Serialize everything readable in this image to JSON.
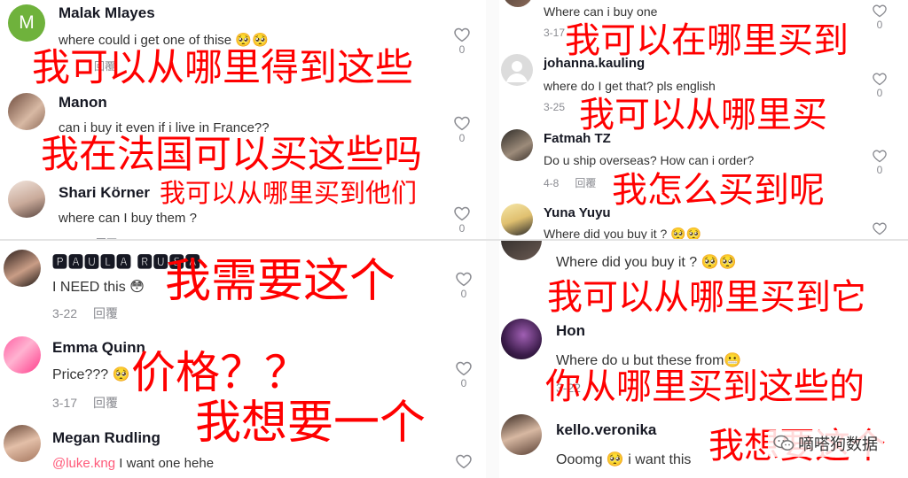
{
  "colors": {
    "overlay_text": "#ff0000",
    "mention": "#ff5a7a",
    "meta": "#8a8b91"
  },
  "panels": {
    "top_left": {
      "comments": [
        {
          "user": "Malak Mlayes",
          "text": "where could i get one of thise 🥺🥺",
          "date": "",
          "reply": "回覆",
          "likes": "0",
          "avatar_letter": "M"
        },
        {
          "user": "Manon",
          "text": "can i buy it even if i live in France??",
          "date": "",
          "reply": "",
          "likes": "0"
        },
        {
          "user": "Shari Körner",
          "text": "where can I buy them ?",
          "date": "3-22",
          "reply": "回覆",
          "likes": "0"
        }
      ],
      "overlays": [
        "我可以从哪里得到这些",
        "我在法国可以买这些吗",
        "我可以从哪里买到他们"
      ]
    },
    "top_right": {
      "comments": [
        {
          "user": "",
          "text": "Where can i buy one",
          "date": "3-17",
          "reply": "",
          "likes": "0"
        },
        {
          "user": "johanna.kauling",
          "text": "where do I get that? pls english",
          "date": "3-25",
          "reply": "",
          "likes": "0"
        },
        {
          "user": "Fatmah TZ",
          "text": "Do u ship overseas? How can i order?",
          "date": "4-8",
          "reply": "回覆",
          "likes": "0"
        },
        {
          "user": "Yuna Yuyu",
          "text": "Where did you buy it ? 🥺🥺",
          "date": "",
          "reply": "",
          "likes": ""
        }
      ],
      "overlays": [
        "我可以在哪里买到",
        "我可以从哪里买",
        "我怎么买到呢"
      ]
    },
    "bottom_left": {
      "comments": [
        {
          "user": "🅿🅰🆄🅻🅰 🆁🆄🆂🅰",
          "text": "I NEED this 😳",
          "date": "3-22",
          "reply": "回覆",
          "likes": "0"
        },
        {
          "user": "Emma Quinn",
          "text": "Price??? 🥺",
          "date": "3-17",
          "reply": "回覆",
          "likes": "0"
        },
        {
          "user": "Megan Rudling",
          "mention": "@luke.kng",
          "text": "I want one hehe",
          "date": "",
          "reply": "",
          "likes": ""
        }
      ],
      "overlays": [
        "我需要这个",
        "价格？？",
        "我想要一个"
      ]
    },
    "bottom_right": {
      "comments": [
        {
          "user": "",
          "text": "Where did you buy it ? 🥺🥺",
          "date": "",
          "reply": "",
          "likes": ""
        },
        {
          "user": "Hon",
          "text": "Where do u but these from😬",
          "date": "3-22",
          "reply": "",
          "likes": ""
        },
        {
          "user": "kello.veronika",
          "text": "Ooomg 🥺 i want this",
          "date": "",
          "reply": "",
          "likes": ""
        }
      ],
      "overlays": [
        "我可以从哪里买到它",
        "你从哪里买到这些的",
        "我想要这个"
      ]
    }
  },
  "watermark": {
    "text": "嘀嗒狗数据",
    "icon": "wechat-icon"
  }
}
